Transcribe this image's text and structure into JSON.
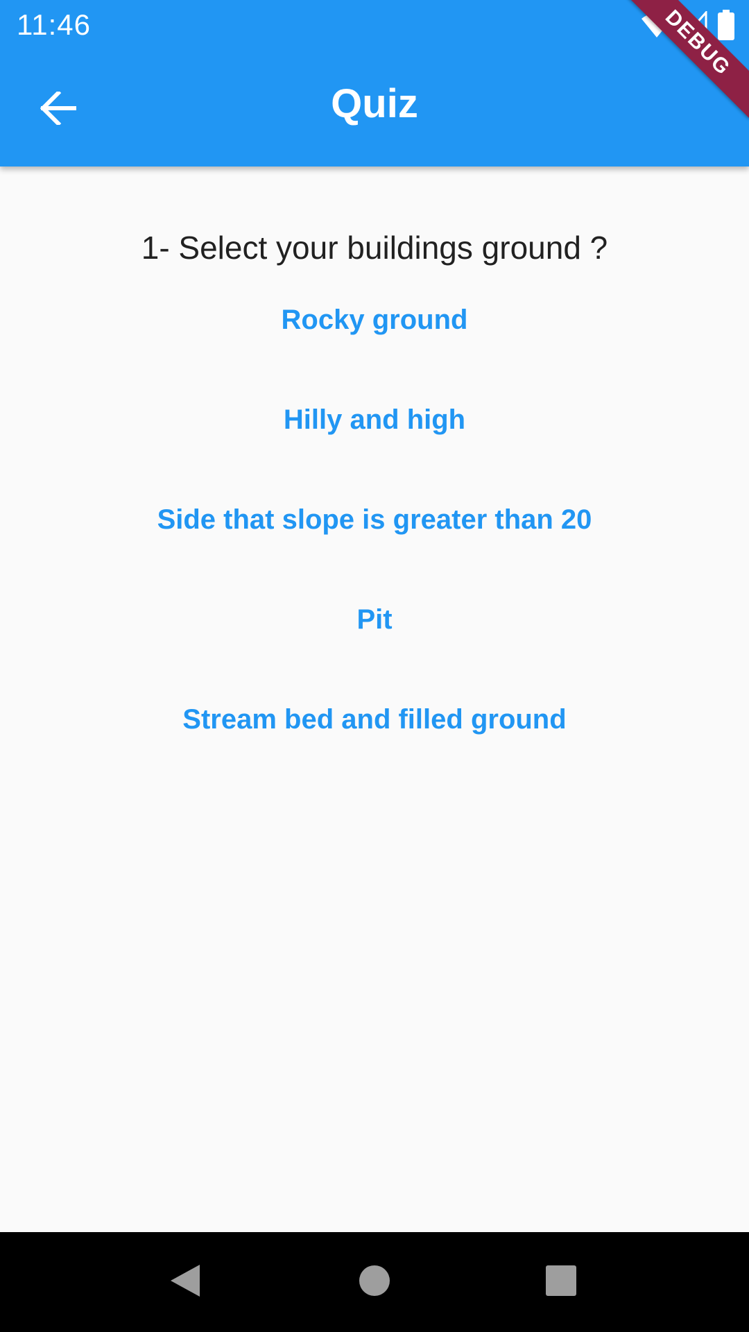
{
  "status_bar": {
    "time": "11:46",
    "icons": [
      "wifi-icon",
      "cell-signal-icon",
      "battery-icon"
    ]
  },
  "app_bar": {
    "title": "Quiz",
    "back_icon": "back-arrow-icon",
    "debug_banner": "DEBUG"
  },
  "quiz": {
    "question": "1- Select your buildings ground ?",
    "answers": [
      "Rocky ground",
      "Hilly and high",
      "Side that slope is greater than 20",
      "Pit",
      "Stream bed and filled ground"
    ]
  },
  "nav_bar": {
    "icons": [
      "nav-back-icon",
      "nav-home-icon",
      "nav-recents-icon"
    ]
  },
  "colors": {
    "primary": "#2196F3",
    "background": "#FAFAFA",
    "debug_banner": "#8E2145",
    "question_text": "#212121",
    "nav_bar": "#000000"
  }
}
